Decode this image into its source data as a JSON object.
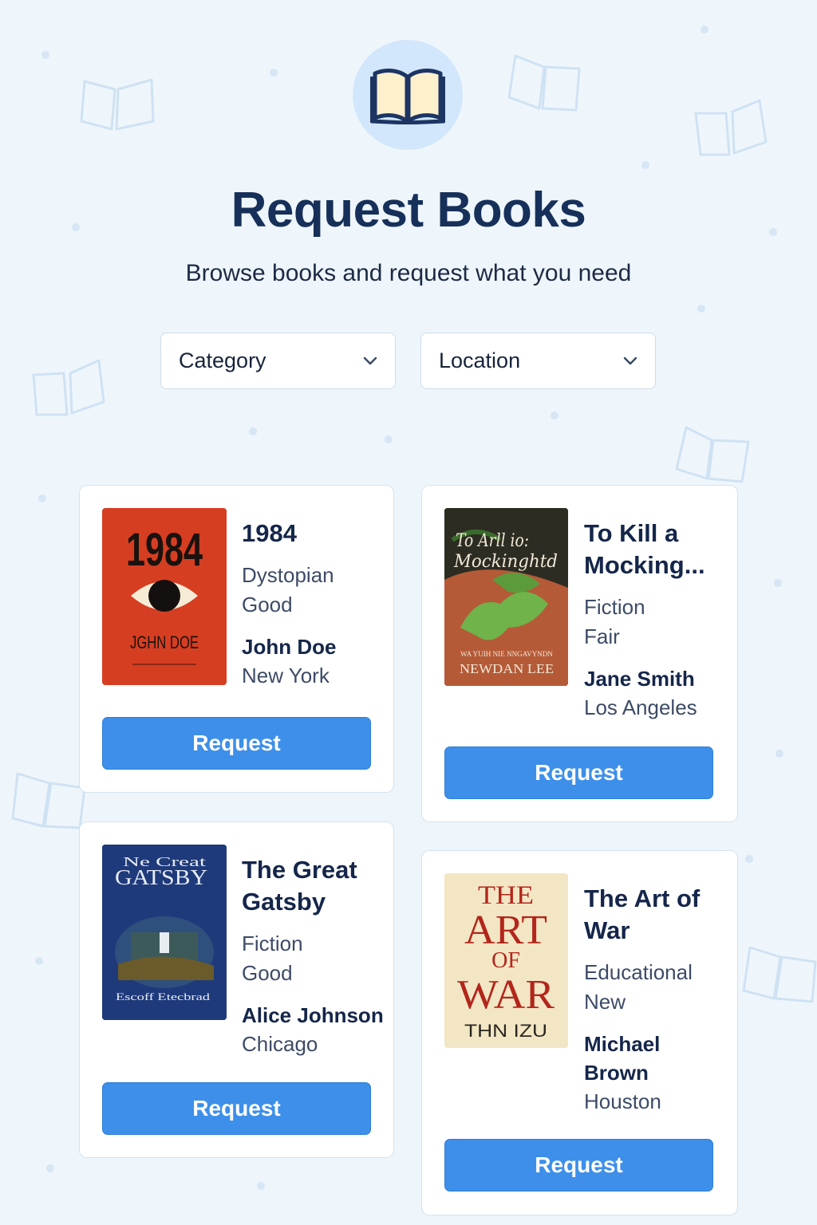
{
  "header": {
    "icon": "open-book-icon",
    "title": "Request Books",
    "subtitle": "Browse books and request what you need"
  },
  "filters": {
    "category_label": "Category",
    "location_label": "Location"
  },
  "books": [
    {
      "title": "1984",
      "category": "Dystopian",
      "condition": "Good",
      "owner": "John Doe",
      "location": "New York",
      "button": "Request",
      "cover": {
        "line1": "1984",
        "author": "JGHN DOE"
      }
    },
    {
      "title": "To Kill a Mocking...",
      "category": "Fiction",
      "condition": "Fair",
      "owner": "Jane Smith",
      "location": "Los Angeles",
      "button": "Request",
      "cover": {
        "line1": "To Arll io:",
        "line2": "Mockinghtd",
        "small": "WA YUIH NIE NNGAVYNDN",
        "author": "NEWDAN LEE"
      }
    },
    {
      "title": "The Great Gatsby",
      "category": "Fiction",
      "condition": "Good",
      "owner": "Alice Johnson",
      "location": "Chicago",
      "button": "Request",
      "cover": {
        "line1": "Ne Creat",
        "line2": "GATSBY",
        "author": "Escoff Etecbrad"
      }
    },
    {
      "title": "The Art of War",
      "category": "Educational",
      "condition": "New",
      "owner": "Michael Brown",
      "location": "Houston",
      "button": "Request",
      "cover": {
        "line1": "THE",
        "line2": "ART",
        "line3": "OF",
        "line4": "WAR",
        "author": "THN IZU"
      }
    }
  ],
  "colors": {
    "background": "#eef6fc",
    "primary_button": "#3d8fe9",
    "title": "#16305a"
  }
}
